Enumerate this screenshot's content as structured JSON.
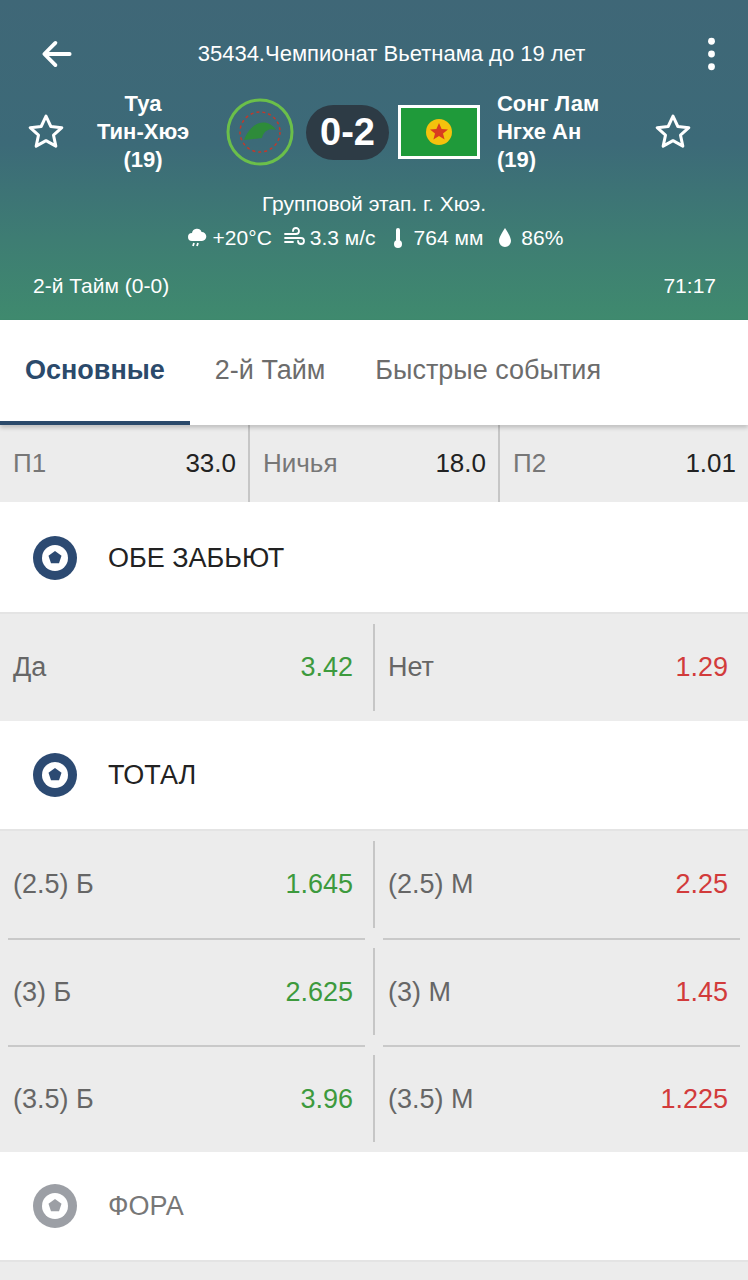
{
  "header": {
    "title": "35434.Чемпионат Вьетнама до 19 лет",
    "home": {
      "lines": [
        "Туа",
        "Тин-Хюэ",
        "(19)"
      ],
      "favorite": false
    },
    "away": {
      "lines": [
        "Сонг Лам",
        "Нгхе Ан",
        "(19)"
      ],
      "favorite": false
    },
    "score": "0-2",
    "stage": "Групповой этап. г. Хюэ.",
    "weather": [
      {
        "kind": "cloud",
        "text": "+20°C"
      },
      {
        "kind": "wind",
        "text": "3.3 м/с"
      },
      {
        "kind": "thermometer",
        "text": "764 мм"
      },
      {
        "kind": "drop",
        "text": "86%"
      }
    ],
    "period": "2-й Тайм (0-0)",
    "clock": "71:17"
  },
  "tabs": [
    {
      "label": "Основные",
      "selected": true
    },
    {
      "label": "2-й  Тайм",
      "selected": false
    },
    {
      "label": "Быстрые события",
      "selected": false
    }
  ],
  "main_odds": [
    {
      "label": "П1",
      "value": "33.0"
    },
    {
      "label": "Ничья",
      "value": "18.0"
    },
    {
      "label": "П2",
      "value": "1.01"
    }
  ],
  "sections": [
    {
      "title": "ОБЕ ЗАБЬЮТ",
      "disabled": false,
      "rows": [
        [
          {
            "label": "Да",
            "value": "3.42",
            "color": "#3d9a3d"
          },
          {
            "label": "Нет",
            "value": "1.29",
            "color": "#d23b3b"
          }
        ]
      ]
    },
    {
      "title": "ТОТАЛ",
      "disabled": false,
      "rows": [
        [
          {
            "label": "(2.5) Б",
            "value": "1.645",
            "color": "#3d9a3d"
          },
          {
            "label": "(2.5) М",
            "value": "2.25",
            "color": "#d23b3b"
          }
        ],
        [
          {
            "label": "(3) Б",
            "value": "2.625",
            "color": "#3d9a3d"
          },
          {
            "label": "(3) М",
            "value": "1.45",
            "color": "#d23b3b"
          }
        ],
        [
          {
            "label": "(3.5) Б",
            "value": "3.96",
            "color": "#3d9a3d"
          },
          {
            "label": "(3.5) М",
            "value": "1.225",
            "color": "#d23b3b"
          }
        ]
      ]
    },
    {
      "title": "ФОРА",
      "disabled": true,
      "rows": []
    }
  ]
}
